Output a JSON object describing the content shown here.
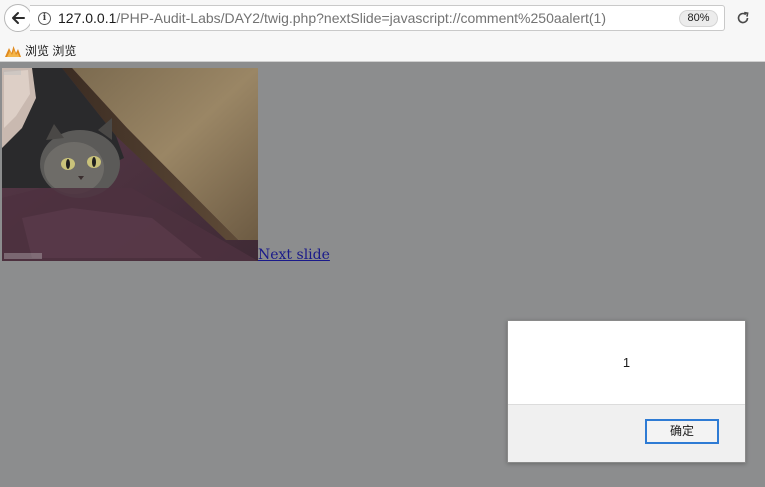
{
  "browser": {
    "url_host": "127.0.0.1",
    "url_path": "/PHP-Audit-Labs/DAY2/twig.php?nextSlide=javascript://comment%250aalert(1)",
    "zoom": "80%"
  },
  "bookmarks": {
    "items": [
      {
        "label": "浏览 浏览"
      }
    ]
  },
  "page": {
    "next_slide_label": "Next slide"
  },
  "alert": {
    "message": "1",
    "ok_label": "确定"
  },
  "colors": {
    "page_overlay": "#8c8d8e",
    "link": "#1a1a8a",
    "dialog_button_border": "#2e7bd4"
  }
}
